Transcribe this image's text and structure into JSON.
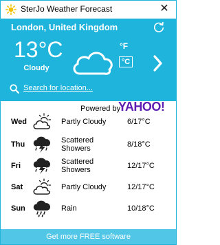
{
  "window": {
    "title": "SterJo Weather Forecast",
    "close_glyph": "✕"
  },
  "current": {
    "location": "London, United Kingdom",
    "temperature": "13°C",
    "condition": "Cloudy",
    "unit_f": "°F",
    "unit_c": "°C",
    "selected_unit": "C"
  },
  "search": {
    "label": "Search for location..."
  },
  "powered": {
    "label": "Powered by",
    "brand": "YAHOO!"
  },
  "forecast": [
    {
      "day": "Wed",
      "condition": "Partly Cloudy",
      "temps": "6/17°C",
      "icon": "partly-cloudy-icon"
    },
    {
      "day": "Thu",
      "condition": "Scattered Showers",
      "temps": "8/18°C",
      "icon": "thunder-showers-icon"
    },
    {
      "day": "Fri",
      "condition": "Scattered Showers",
      "temps": "12/17°C",
      "icon": "thunder-showers-icon"
    },
    {
      "day": "Sat",
      "condition": "Partly Cloudy",
      "temps": "12/17°C",
      "icon": "partly-cloudy-icon"
    },
    {
      "day": "Sun",
      "condition": "Rain",
      "temps": "10/18°C",
      "icon": "rain-icon"
    }
  ],
  "footer": {
    "label": "Get more FREE software"
  },
  "colors": {
    "accent": "#1eb4dc",
    "footer": "#52c6e6",
    "brand": "#5f1db3"
  }
}
